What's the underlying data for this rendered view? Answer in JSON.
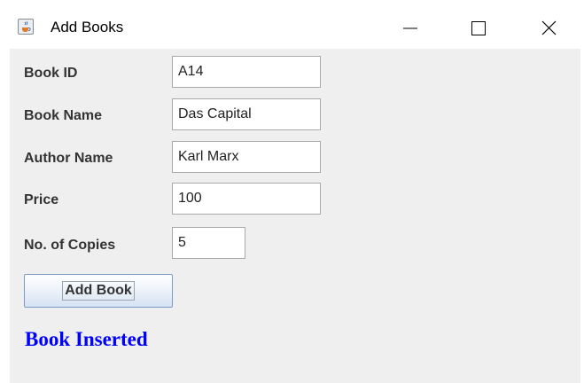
{
  "window": {
    "title": "Add Books",
    "app_icon": "java-cup-icon",
    "controls": [
      "minimize-icon",
      "maximize-icon",
      "close-icon"
    ]
  },
  "form": {
    "book_id": {
      "label": "Book ID",
      "value": "A14"
    },
    "book_name": {
      "label": "Book Name",
      "value": "Das Capital"
    },
    "author_name": {
      "label": "Author Name",
      "value": "Karl Marx"
    },
    "price": {
      "label": "Price",
      "value": "100"
    },
    "copies": {
      "label": "No. of Copies",
      "value": "5"
    },
    "submit_label": "Add Book"
  },
  "status": {
    "message": "Book Inserted",
    "color": "#0000ff"
  },
  "colors": {
    "panel": "#efefef",
    "label": "#333333"
  }
}
